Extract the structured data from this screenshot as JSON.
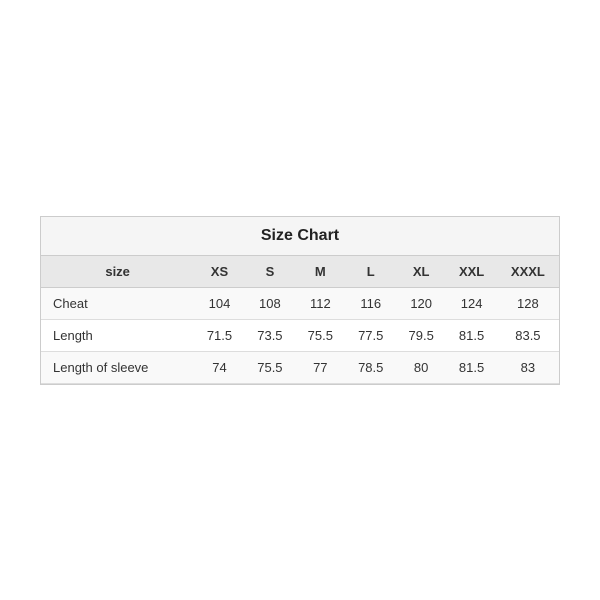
{
  "chart": {
    "title": "Size Chart",
    "headers": {
      "size_label": "size",
      "columns": [
        "XS",
        "S",
        "M",
        "L",
        "XL",
        "XXL",
        "XXXL"
      ]
    },
    "rows": [
      {
        "label": "Cheat",
        "values": [
          "104",
          "108",
          "112",
          "116",
          "120",
          "124",
          "128"
        ]
      },
      {
        "label": "Length",
        "values": [
          "71.5",
          "73.5",
          "75.5",
          "77.5",
          "79.5",
          "81.5",
          "83.5"
        ]
      },
      {
        "label": "Length of sleeve",
        "values": [
          "74",
          "75.5",
          "77",
          "78.5",
          "80",
          "81.5",
          "83"
        ]
      }
    ]
  }
}
